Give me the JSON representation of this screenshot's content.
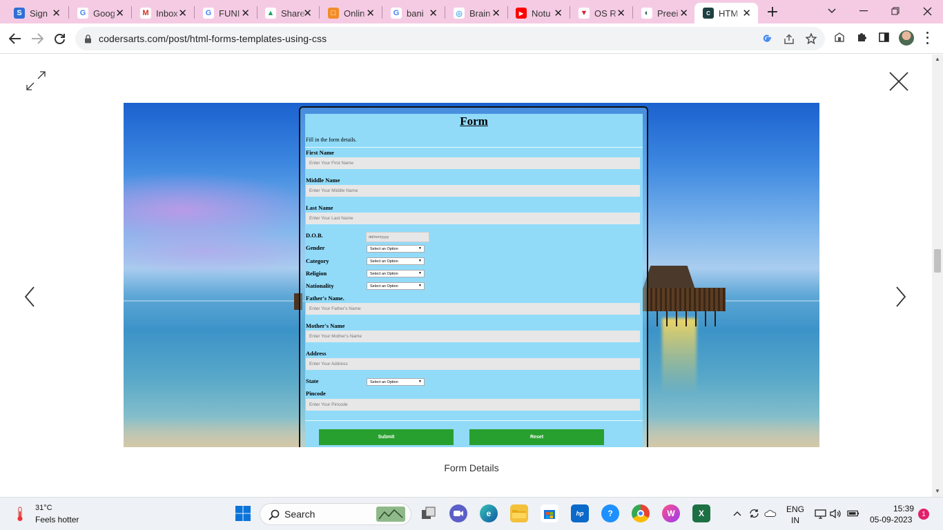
{
  "browser": {
    "tabs": [
      {
        "label": "Sign",
        "favicon_letter": "S",
        "favicon_color": "#2f6fd6"
      },
      {
        "label": "Goog",
        "favicon_letter": "G",
        "favicon_color": "#4285f4"
      },
      {
        "label": "Inbox",
        "favicon_letter": "M",
        "favicon_color": "#d93025"
      },
      {
        "label": "FUNI",
        "favicon_letter": "G",
        "favicon_color": "#4285f4"
      },
      {
        "label": "Share",
        "favicon_letter": "▲",
        "favicon_color": "#1fa463"
      },
      {
        "label": "Onlin",
        "favicon_letter": "□",
        "favicon_color": "#f28c28"
      },
      {
        "label": "bani",
        "favicon_letter": "G",
        "favicon_color": "#4285f4"
      },
      {
        "label": "Brain",
        "favicon_letter": "◎",
        "favicon_color": "#5ab1e8"
      },
      {
        "label": "Notu",
        "favicon_letter": "▶",
        "favicon_color": "#ff0000"
      },
      {
        "label": "OS R",
        "favicon_letter": "▼",
        "favicon_color": "#e0203a"
      },
      {
        "label": "Preei",
        "favicon_letter": "◐",
        "favicon_color": "#1d5e52"
      },
      {
        "label": "HTM",
        "favicon_letter": "C",
        "favicon_color": "#1e3f3f",
        "active": true
      }
    ],
    "url": "codersarts.com/post/html-forms-templates-using-css"
  },
  "viewer": {
    "caption": "Form Details"
  },
  "form": {
    "title": "Form",
    "description": "Fill in the form details.",
    "fields": {
      "first_name": {
        "label": "First Name",
        "placeholder": "Enter Your First Name"
      },
      "middle_name": {
        "label": "Middle Name",
        "placeholder": "Enter Your Middle Name"
      },
      "last_name": {
        "label": "Last Name",
        "placeholder": "Enter Your Last Name"
      },
      "dob": {
        "label": "D.O.B.",
        "placeholder": "dd/mm/yyyy"
      },
      "gender": {
        "label": "Gender",
        "value": "Select an Option"
      },
      "category": {
        "label": "Category",
        "value": "Select an Option"
      },
      "religion": {
        "label": "Religion",
        "value": "Select an Option"
      },
      "nationality": {
        "label": "Nationality",
        "value": "Select an Option"
      },
      "father_name": {
        "label": "Father's Name.",
        "placeholder": "Enter Your Father's Name"
      },
      "mother_name": {
        "label": "Mother's Name",
        "placeholder": "Enter Your Mother's Name"
      },
      "address": {
        "label": "Address",
        "placeholder": "Enter Your Address"
      },
      "state": {
        "label": "State",
        "value": "Select an Option"
      },
      "pincode": {
        "label": "Pincode",
        "placeholder": "Enter Your Pincode"
      }
    },
    "buttons": {
      "submit": "Submit",
      "reset": "Reset"
    }
  },
  "taskbar": {
    "weather_temp": "31°C",
    "weather_desc": "Feels hotter",
    "search_label": "Search",
    "lang_line1": "ENG",
    "lang_line2": "IN",
    "time": "15:39",
    "date": "05-09-2023",
    "notification_count": "1"
  },
  "colors": {
    "tabbar": "#f5cbe4",
    "form_bg": "#91dbf9",
    "button_green": "#28a02f"
  }
}
